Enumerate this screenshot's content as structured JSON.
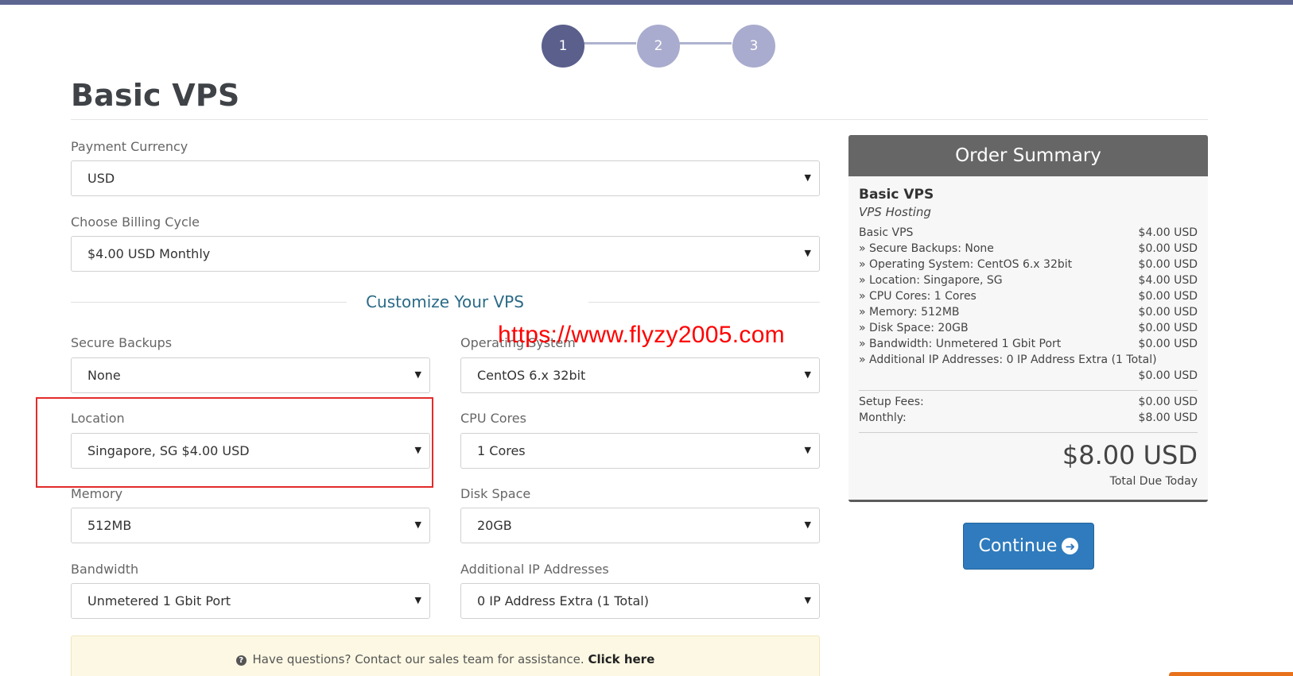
{
  "steps": [
    "1",
    "2",
    "3"
  ],
  "page_title": "Basic VPS",
  "payment_currency": {
    "label": "Payment Currency",
    "value": "USD"
  },
  "billing_cycle": {
    "label": "Choose Billing Cycle",
    "value": "$4.00 USD Monthly"
  },
  "customize_title": "Customize Your VPS",
  "options": {
    "secure_backups": {
      "label": "Secure Backups",
      "value": "None"
    },
    "operating_system": {
      "label": "Operating System",
      "value": "CentOS 6.x 32bit"
    },
    "location": {
      "label": "Location",
      "value": "Singapore, SG $4.00 USD"
    },
    "cpu_cores": {
      "label": "CPU Cores",
      "value": "1 Cores"
    },
    "memory": {
      "label": "Memory",
      "value": "512MB"
    },
    "disk_space": {
      "label": "Disk Space",
      "value": "20GB"
    },
    "bandwidth": {
      "label": "Bandwidth",
      "value": "Unmetered 1 Gbit Port"
    },
    "additional_ip": {
      "label": "Additional IP Addresses",
      "value": "0 IP Address Extra (1 Total)"
    }
  },
  "watermark": "https://www.flyzy2005.com",
  "help": {
    "text": "Have questions? Contact our sales team for assistance.",
    "link": "Click here"
  },
  "summary": {
    "title": "Order Summary",
    "product": "Basic VPS",
    "group": "VPS Hosting",
    "lines": [
      {
        "label": "Basic VPS",
        "amount": "$4.00 USD"
      },
      {
        "label": "» Secure Backups: None",
        "amount": "$0.00 USD"
      },
      {
        "label": "» Operating System: CentOS 6.x 32bit",
        "amount": "$0.00 USD"
      },
      {
        "label": "» Location: Singapore, SG",
        "amount": "$4.00 USD"
      },
      {
        "label": "» CPU Cores: 1 Cores",
        "amount": "$0.00 USD"
      },
      {
        "label": "» Memory: 512MB",
        "amount": "$0.00 USD"
      },
      {
        "label": "» Disk Space: 20GB",
        "amount": "$0.00 USD"
      },
      {
        "label": "» Bandwidth: Unmetered 1 Gbit Port",
        "amount": "$0.00 USD"
      },
      {
        "label": "» Additional IP Addresses: 0 IP Address Extra (1 Total)",
        "amount": "$0.00 USD"
      }
    ],
    "setup_fees": {
      "label": "Setup Fees:",
      "amount": "$0.00 USD"
    },
    "monthly": {
      "label": "Monthly:",
      "amount": "$8.00 USD"
    },
    "total": "$8.00 USD",
    "total_label": "Total Due Today"
  },
  "continue_label": "Continue"
}
